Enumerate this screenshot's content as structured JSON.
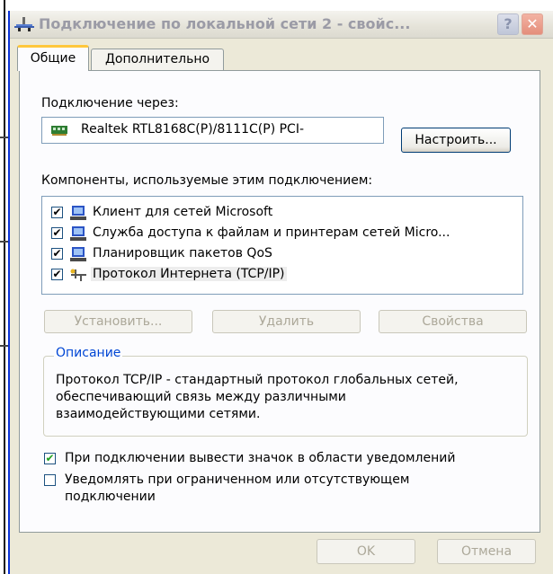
{
  "window": {
    "title": "Подключение по локальной сети 2 - свойс...",
    "help_button": "?",
    "close_button": "✕"
  },
  "tabs": [
    {
      "label": "Общие",
      "active": true
    },
    {
      "label": "Дополнительно",
      "active": false
    }
  ],
  "connect_using": {
    "label": "Подключение через:",
    "adapter": "Realtek RTL8168C(P)/8111C(P) PCI-",
    "configure_button": "Настроить..."
  },
  "components": {
    "label": "Компоненты, используемые этим подключением:",
    "items": [
      {
        "label": "Клиент для сетей Microsoft",
        "checked": true,
        "icon": "network-client-icon"
      },
      {
        "label": "Служба доступа к файлам и принтерам сетей Micro...",
        "checked": true,
        "icon": "network-service-icon"
      },
      {
        "label": "Планировщик пакетов QoS",
        "checked": true,
        "icon": "network-service-icon"
      },
      {
        "label": "Протокол Интернета (TCP/IP)",
        "checked": true,
        "icon": "protocol-icon",
        "selected": true
      }
    ]
  },
  "actions": {
    "install": "Установить...",
    "uninstall": "Удалить",
    "properties": "Свойства"
  },
  "description": {
    "title": "Описание",
    "text": "Протокол TCP/IP - стандартный протокол глобальных сетей, обеспечивающий связь между различными взаимодействующими сетями."
  },
  "options": [
    {
      "label": "При подключении вывести значок в области уведомлений",
      "checked": true
    },
    {
      "label": "Уведомлять при ограниченном или отсутствующем подключении",
      "checked": false
    }
  ],
  "footer": {
    "ok": "OK",
    "cancel": "Отмена"
  },
  "colors": {
    "dialog_bg": "#ece9d8",
    "panel_bg": "#fcfcfe",
    "group_title": "#0046d5",
    "active_tab_accent": "#ffc83c",
    "disabled_text": "#aca899"
  }
}
